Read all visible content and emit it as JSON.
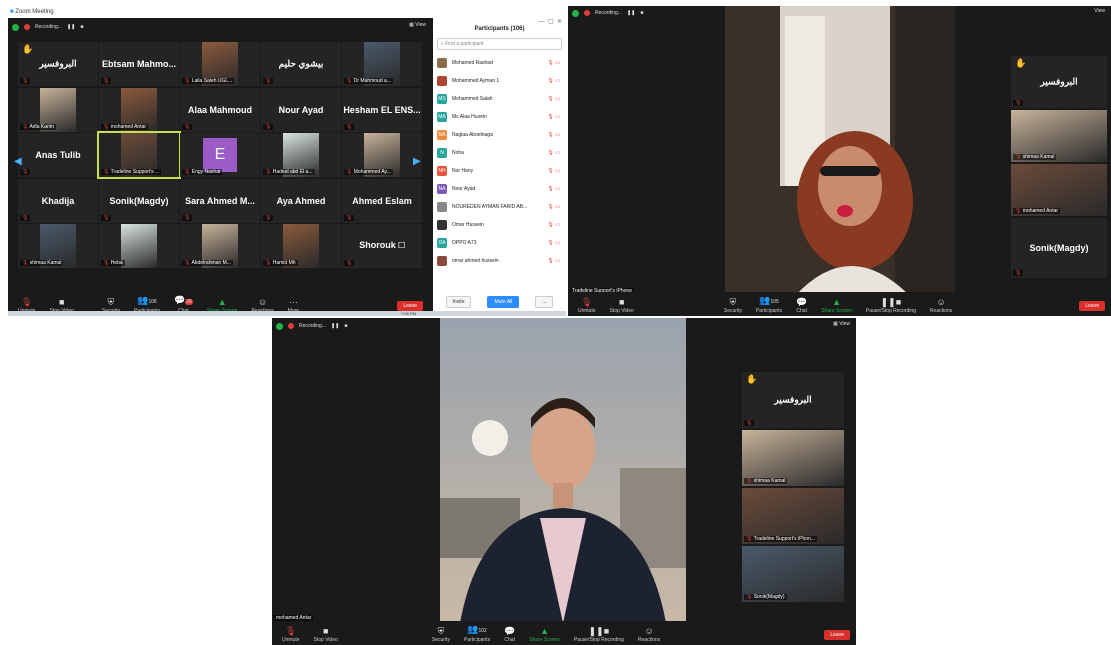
{
  "window": {
    "title": "Zoom Meeting"
  },
  "recording": {
    "label": "Recording..."
  },
  "view_label": "View",
  "grid": {
    "rows": [
      [
        {
          "name": "البروفسير",
          "label": "",
          "hand": true
        },
        {
          "name": "Ebtsam Mahmo...",
          "label": ""
        },
        {
          "name": "",
          "label": "Laila Saleh UGL..."
        },
        {
          "name": "بيشوي حليم",
          "label": ""
        },
        {
          "name": "",
          "label": "Dr Mahmoud a..."
        }
      ],
      [
        {
          "name": "",
          "label": "Adla Karim"
        },
        {
          "name": "",
          "label": "mohamed Antar"
        },
        {
          "name": "Alaa Mahmoud",
          "label": ""
        },
        {
          "name": "Nour Ayad",
          "label": ""
        },
        {
          "name": "Hesham EL ENS...",
          "label": ""
        }
      ],
      [
        {
          "name": "Anas Tulib",
          "label": ""
        },
        {
          "name": "",
          "label": "Tradeline Support's ..."
        },
        {
          "name": "E",
          "label": "Engy Nashat"
        },
        {
          "name": "",
          "label": "Hadeel abd El a..."
        },
        {
          "name": "",
          "label": "Mohammed Ay..."
        }
      ],
      [
        {
          "name": "Khadija",
          "label": ""
        },
        {
          "name": "Sonik(Magdy)",
          "label": ""
        },
        {
          "name": "Sara Ahmed M...",
          "label": ""
        },
        {
          "name": "Aya Ahmed",
          "label": ""
        },
        {
          "name": "Ahmed Eslam",
          "label": ""
        }
      ],
      [
        {
          "name": "",
          "label": "shimaa Kamal"
        },
        {
          "name": "",
          "label": "Heba"
        },
        {
          "name": "",
          "label": "Abdelrahman M..."
        },
        {
          "name": "",
          "label": "Hamid Mh"
        },
        {
          "name": "Shorouk 🗆",
          "label": ""
        }
      ]
    ],
    "page_left": "1/5",
    "page_right": "1/5"
  },
  "toolbar": {
    "unmute": "Unmute",
    "stop_video": "Stop Video",
    "security": "Security",
    "participants": "Participants",
    "participants_count": "106",
    "chat": "Chat",
    "chat_badge": "26",
    "share_screen": "Share Screen",
    "reactions": "Reactions",
    "more": "More",
    "leave": "Leave",
    "pause_stop": "Pause/Stop Recording"
  },
  "participants_panel": {
    "title": "Participants (106)",
    "search_placeholder": "Find a participant",
    "items": [
      {
        "initials": "",
        "name": "Mohamed Rashad",
        "color": "#8a6d4a"
      },
      {
        "initials": "",
        "name": "Mohammed Ayman 1",
        "color": "#b2452f"
      },
      {
        "initials": "MS",
        "name": "Mohammed Salah",
        "color": "#26a69a"
      },
      {
        "initials": "MA",
        "name": "Mc Alaa Husein",
        "color": "#26a69a"
      },
      {
        "initials": "NA",
        "name": "Naglaa Aboelnaga",
        "color": "#ef8a3c"
      },
      {
        "initials": "N",
        "name": "Noha",
        "color": "#26a69a"
      },
      {
        "initials": "NH",
        "name": "Nor Hany",
        "color": "#e5533c"
      },
      {
        "initials": "NA",
        "name": "Nour Ayad",
        "color": "#7d58b8"
      },
      {
        "initials": "",
        "name": "NOUREDEN AYMAN FARID AB...",
        "color": "#888"
      },
      {
        "initials": "",
        "name": "Omar Hussein",
        "color": "#333"
      },
      {
        "initials": "OA",
        "name": "OPPO A73",
        "color": "#26a69a"
      },
      {
        "initials": "",
        "name": "omar ahmed hussein",
        "color": "#8a4a3c"
      }
    ],
    "invite": "Invite",
    "mute_all": "Mute All",
    "more": "..."
  },
  "speaker_view_1": {
    "speaker_label": "Tradeline Support's iPhone",
    "side_tiles": [
      {
        "name": "البروفسير",
        "label": ""
      },
      {
        "name": "",
        "label": "shimaa Kamal"
      },
      {
        "name": "",
        "label": "mohamed Antar"
      },
      {
        "name": "Sonik(Magdy)",
        "label": ""
      }
    ],
    "participants_count": "105"
  },
  "speaker_view_2": {
    "speaker_label": "mohamed Antar",
    "side_tiles": [
      {
        "name": "البروفسير",
        "label": ""
      },
      {
        "name": "",
        "label": "shimaa Kamal"
      },
      {
        "name": "",
        "label": "Tradeline Support's iPhon..."
      },
      {
        "name": "",
        "label": "Sonik(Magdy)"
      }
    ],
    "participants_count": "102"
  },
  "taskbar_time": "7:06 PM"
}
